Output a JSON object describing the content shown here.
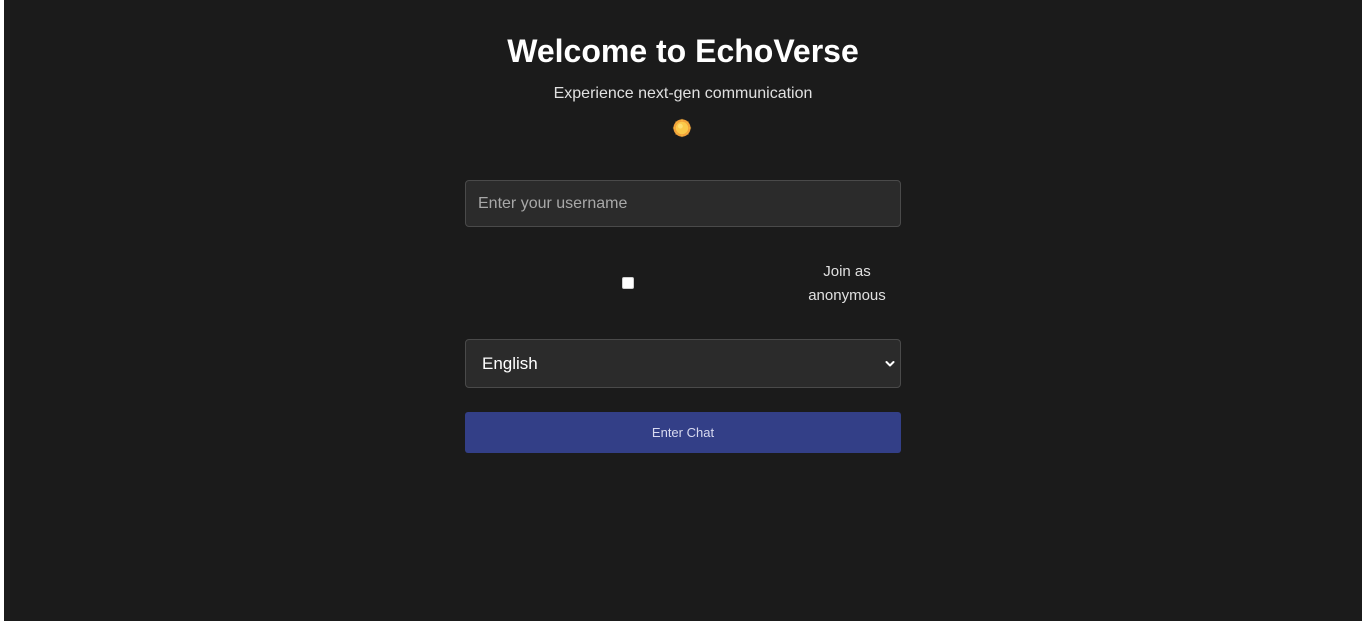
{
  "header": {
    "title": "Welcome to EchoVerse",
    "subtitle": "Experience next-gen communication",
    "theme_icon": "sun-icon"
  },
  "form": {
    "username_placeholder": "Enter your username",
    "username_value": "",
    "anonymous_label_line1": "Join as",
    "anonymous_label_line2": "anonymous",
    "anonymous_checked": false,
    "language_selected": "English",
    "submit_label": "Enter Chat"
  },
  "colors": {
    "background": "#1b1b1b",
    "input_background": "#2b2b2b",
    "button_background": "#333f87",
    "sun": "#f5a623"
  }
}
